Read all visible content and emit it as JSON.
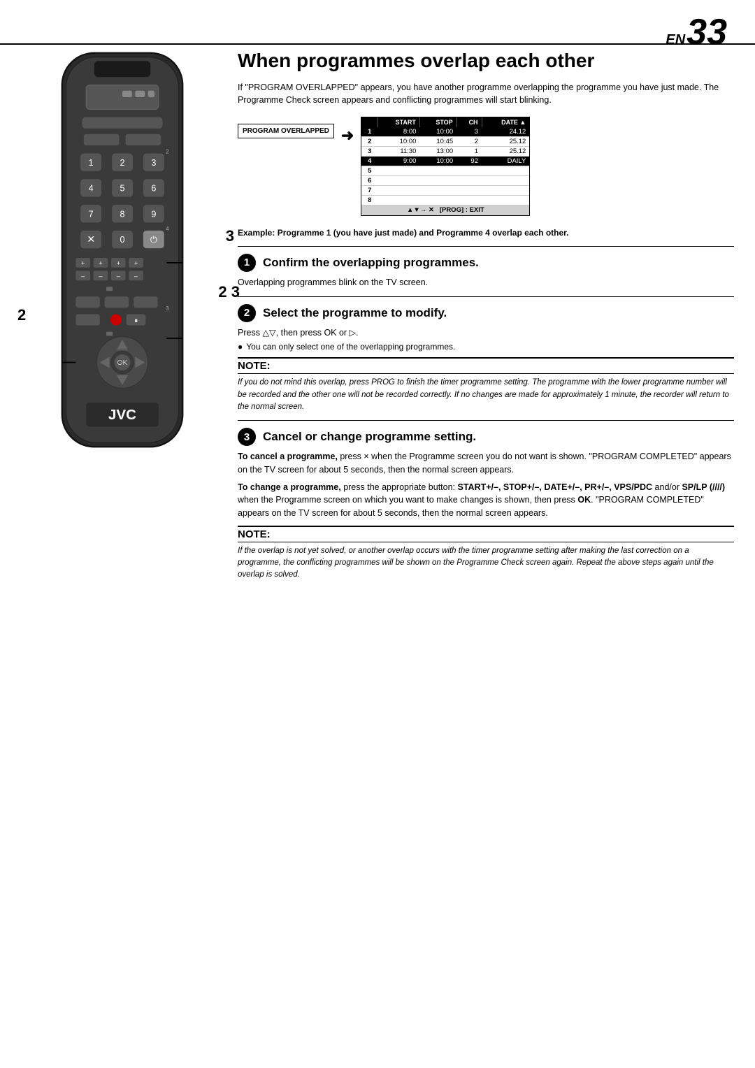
{
  "page": {
    "en_label": "EN",
    "page_number": "33"
  },
  "title": "When programmes overlap each other",
  "intro": "If \"PROGRAM OVERLAPPED\" appears, you have another programme overlapping the programme you have just made. The Programme Check screen appears and conflicting programmes will start blinking.",
  "program_display": {
    "label": "PROGRAM OVERLAPPED",
    "arrow": "➜",
    "table": {
      "headers": [
        "",
        "START",
        "STOP",
        "CH",
        "DATE"
      ],
      "rows": [
        {
          "num": "1",
          "start": "8:00",
          "stop": "10:00",
          "ch": "3",
          "date": "24.12",
          "highlight": true
        },
        {
          "num": "2",
          "start": "10:00",
          "stop": "10:45",
          "ch": "2",
          "date": "25.12",
          "highlight": false
        },
        {
          "num": "3",
          "start": "11:30",
          "stop": "13:00",
          "ch": "1",
          "date": "25.12",
          "highlight": false
        },
        {
          "num": "4",
          "start": "9:00",
          "stop": "10:00",
          "ch": "92",
          "date": "DAILY",
          "highlight": true
        },
        {
          "num": "5",
          "start": "",
          "stop": "",
          "ch": "",
          "date": "",
          "highlight": false
        },
        {
          "num": "6",
          "start": "",
          "stop": "",
          "ch": "",
          "date": "",
          "highlight": false
        },
        {
          "num": "7",
          "start": "",
          "stop": "",
          "ch": "",
          "date": "",
          "highlight": false
        },
        {
          "num": "8",
          "start": "",
          "stop": "",
          "ch": "",
          "date": "",
          "highlight": false
        }
      ],
      "footer": "▲▼→ ✕\n[PROG] : EXIT"
    }
  },
  "example_text": "Example: Programme 1 (you have just made) and Programme 4 overlap each other.",
  "steps": [
    {
      "number": "1",
      "title": "Confirm the overlapping programmes.",
      "body": "Overlapping programmes blink on the TV screen."
    },
    {
      "number": "2",
      "title": "Select the programme to modify.",
      "body": "Press △▽, then press OK or ▷.",
      "bullet": "You can only select one of the overlapping programmes."
    },
    {
      "note1": {
        "heading": "NOTE:",
        "text": "If you do not mind this overlap, press PROG to finish the timer programme setting. The programme with the lower programme number will be recorded and the other one will not be recorded correctly. If no changes are made for approximately 1 minute, the recorder will return to the normal screen."
      }
    },
    {
      "number": "3",
      "title": "Cancel or change programme setting.",
      "body1": "To cancel a programme, press × when the Programme screen you do not want is shown. \"PROGRAM COMPLETED\" appears on the TV screen for about 5 seconds, then the normal screen appears.",
      "body2": "To change a programme, press the appropriate button: START+/–, STOP+/–, DATE+/–, PR+/–, VPS/PDC and/or SP/LP (/////) when the Programme screen on which you want to make changes is shown, then press OK. \"PROGRAM COMPLETED\" appears on the TV screen for about 5 seconds, then the normal screen appears."
    }
  ],
  "note2": {
    "heading": "NOTE:",
    "text": "If the overlap is not yet solved, or another overlap occurs with the timer programme setting after making the last correction on a programme, the conflicting programmes will be shown on the Programme Check screen again. Repeat the above steps again until the overlap is solved."
  },
  "remote": {
    "label": "JVC",
    "marker_2_left": "2",
    "marker_23_right": "2 3",
    "step3_right": "3"
  }
}
